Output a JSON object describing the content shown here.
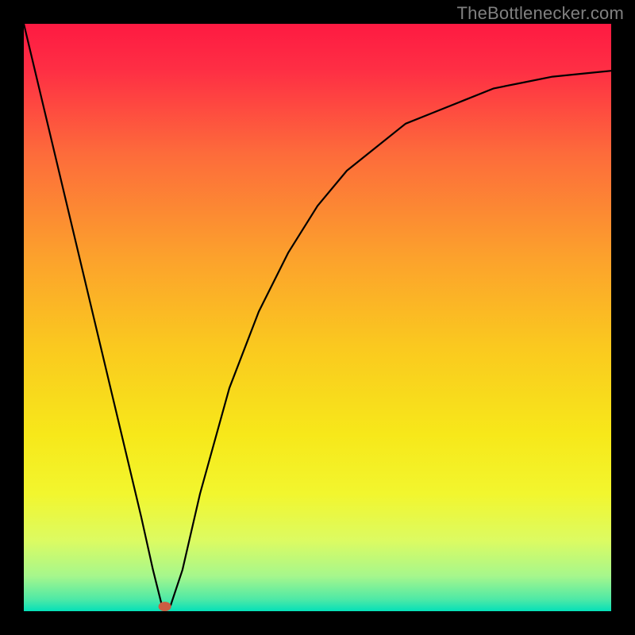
{
  "attribution": "TheBottlenecker.com",
  "chart_data": {
    "type": "line",
    "title": "",
    "xlabel": "",
    "ylabel": "",
    "xlim": [
      0,
      100
    ],
    "ylim": [
      0,
      100
    ],
    "gradient_stops": [
      {
        "offset": 0,
        "color": "#FE1A42"
      },
      {
        "offset": 0.08,
        "color": "#FE2F44"
      },
      {
        "offset": 0.22,
        "color": "#FD6B3B"
      },
      {
        "offset": 0.4,
        "color": "#FCA22C"
      },
      {
        "offset": 0.55,
        "color": "#FAC91F"
      },
      {
        "offset": 0.7,
        "color": "#F7E81A"
      },
      {
        "offset": 0.8,
        "color": "#F2F62E"
      },
      {
        "offset": 0.88,
        "color": "#DCFB62"
      },
      {
        "offset": 0.94,
        "color": "#A6F78C"
      },
      {
        "offset": 0.98,
        "color": "#4EE9A6"
      },
      {
        "offset": 1.0,
        "color": "#05E0B9"
      }
    ],
    "series": [
      {
        "name": "bottleneck-curve",
        "x": [
          0,
          5,
          10,
          15,
          20,
          22,
          23.5,
          25,
          27,
          30,
          35,
          40,
          45,
          50,
          55,
          60,
          65,
          70,
          75,
          80,
          85,
          90,
          95,
          100
        ],
        "y": [
          100,
          79,
          58,
          37,
          16,
          7,
          1,
          1,
          7,
          20,
          38,
          51,
          61,
          69,
          75,
          79,
          83,
          85,
          87,
          89,
          90,
          91,
          91.5,
          92
        ]
      }
    ],
    "marker": {
      "x": 24,
      "y": 0.8,
      "color": "#CB5D42",
      "rx": 8,
      "ry": 6
    },
    "curve_stroke": "#000000",
    "curve_width": 2.2
  }
}
